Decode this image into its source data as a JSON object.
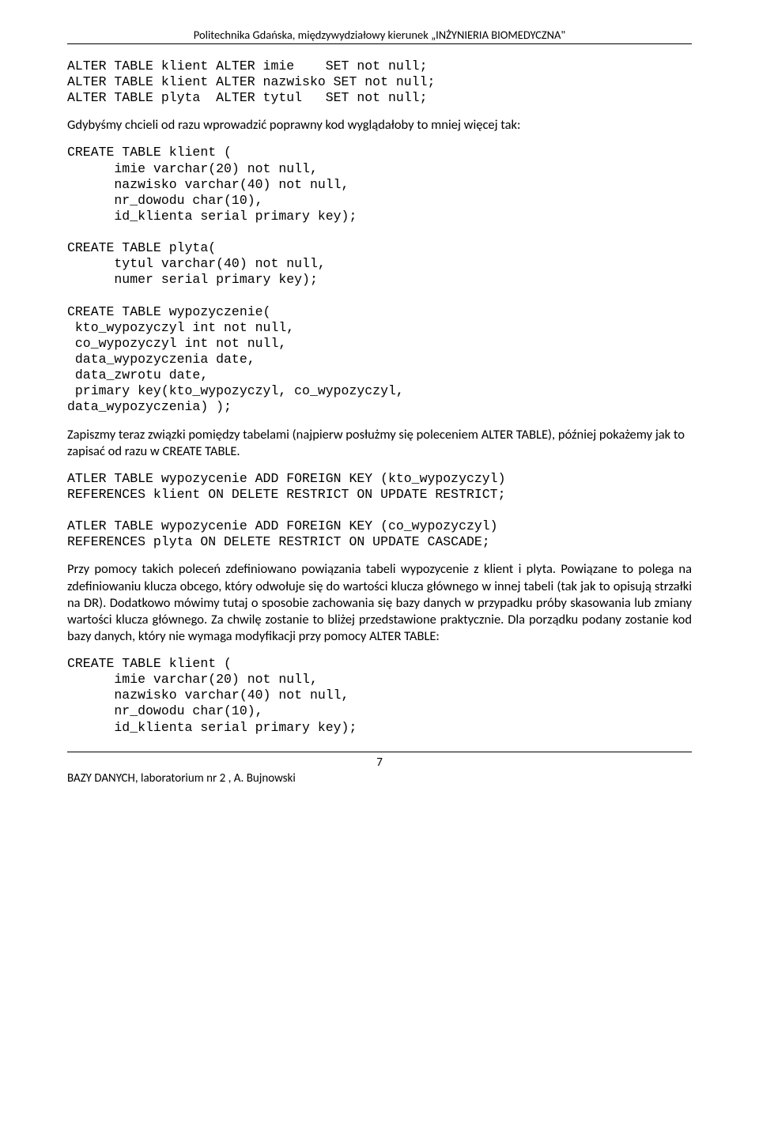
{
  "header": "Politechnika Gdańska, międzywydziałowy kierunek „INŻYNIERIA BIOMEDYCZNA\"",
  "code1": "ALTER TABLE klient ALTER imie    SET not null;\nALTER TABLE klient ALTER nazwisko SET not null;\nALTER TABLE plyta  ALTER tytul   SET not null;",
  "para1": "Gdybyśmy chcieli od razu wprowadzić poprawny kod wyglądałoby to mniej więcej tak:",
  "code2": "CREATE TABLE klient (\n      imie varchar(20) not null,\n      nazwisko varchar(40) not null,\n      nr_dowodu char(10),\n      id_klienta serial primary key);\n\nCREATE TABLE plyta(\n      tytul varchar(40) not null,\n      numer serial primary key);\n\nCREATE TABLE wypozyczenie(\n kto_wypozyczyl int not null,\n co_wypozyczyl int not null,\n data_wypozyczenia date,\n data_zwrotu date,\n primary key(kto_wypozyczyl, co_wypozyczyl,\ndata_wypozyczenia) );",
  "para2": "Zapiszmy teraz związki pomiędzy tabelami (najpierw posłużmy się poleceniem ALTER TABLE), później pokażemy jak to zapisać od razu w CREATE TABLE.",
  "code3": "ATLER TABLE wypozycenie ADD FOREIGN KEY (kto_wypozyczyl)\nREFERENCES klient ON DELETE RESTRICT ON UPDATE RESTRICT;\n\nATLER TABLE wypozycenie ADD FOREIGN KEY (co_wypozyczyl)\nREFERENCES plyta ON DELETE RESTRICT ON UPDATE CASCADE;",
  "para3": "Przy pomocy takich poleceń zdefiniowano powiązania tabeli wypozycenie z klient i plyta. Powiązane to polega na zdefiniowaniu klucza obcego, który odwołuje się do wartości klucza głównego w innej tabeli (tak jak to opisują strzałki na DR). Dodatkowo mówimy tutaj o sposobie zachowania się bazy danych w przypadku próby skasowania lub zmiany wartości klucza głównego. Za chwilę zostanie to bliżej przedstawione praktycznie. Dla porządku podany zostanie kod bazy danych, który nie wymaga modyfikacji przy pomocy ALTER TABLE:",
  "code4": "CREATE TABLE klient (\n      imie varchar(20) not null,\n      nazwisko varchar(40) not null,\n      nr_dowodu char(10),\n      id_klienta serial primary key);",
  "pageNumber": "7",
  "footer": "BAZY DANYCH, laboratorium nr 2 , A. Bujnowski"
}
